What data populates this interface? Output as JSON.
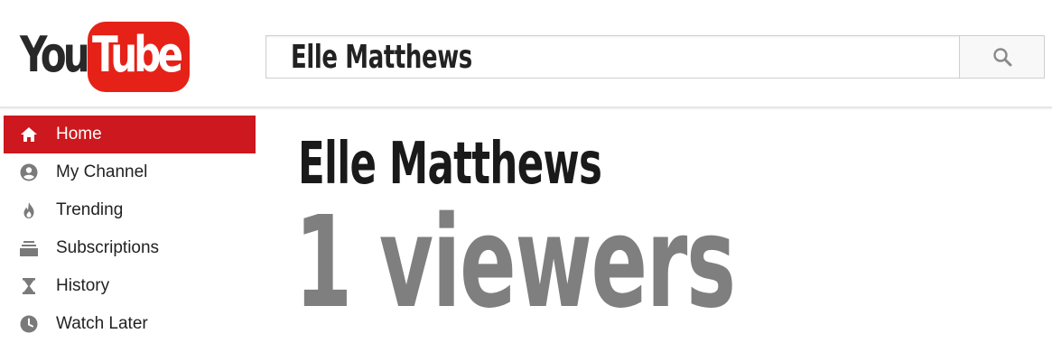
{
  "logo": {
    "you": "You",
    "tube": "Tube",
    "brand_color": "#e62117"
  },
  "search": {
    "value": "Elle Matthews",
    "button_icon": "search-icon"
  },
  "sidebar": {
    "active_color": "#cc181e",
    "items": [
      {
        "label": "Home",
        "icon": "home-icon",
        "active": true
      },
      {
        "label": "My Channel",
        "icon": "account-icon",
        "active": false
      },
      {
        "label": "Trending",
        "icon": "flame-icon",
        "active": false
      },
      {
        "label": "Subscriptions",
        "icon": "subscriptions-icon",
        "active": false
      },
      {
        "label": "History",
        "icon": "hourglass-icon",
        "active": false
      },
      {
        "label": "Watch Later",
        "icon": "clock-icon",
        "active": false
      }
    ]
  },
  "main": {
    "channel_name": "Elle Matthews",
    "viewers_text": "1 viewers"
  }
}
